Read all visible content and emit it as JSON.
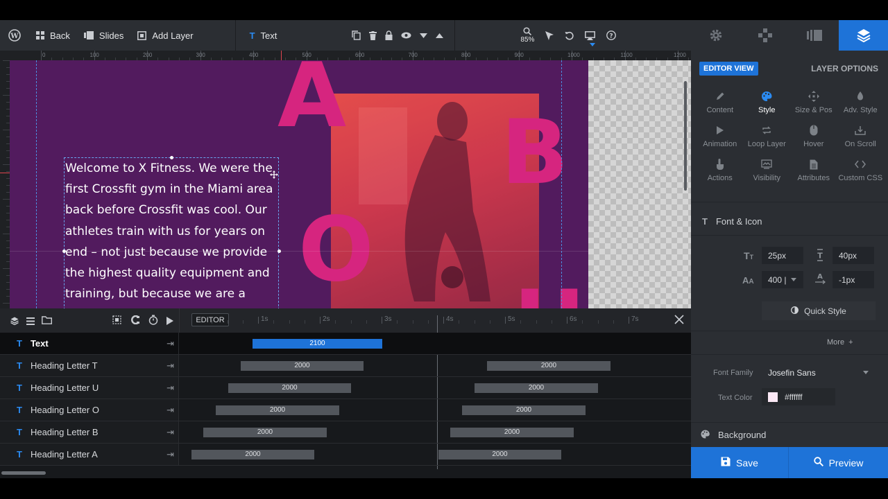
{
  "toolbar": {
    "back": "Back",
    "slides": "Slides",
    "add_layer": "Add Layer",
    "layer_type": "Text",
    "zoom": "85%"
  },
  "ruler_ticks": [
    "0",
    "100",
    "200",
    "300",
    "400",
    "500",
    "600",
    "700",
    "800",
    "900",
    "1000",
    "1100",
    "1200"
  ],
  "slide": {
    "letters": [
      "A",
      "B",
      "O",
      "U"
    ],
    "text": "Welcome to X Fitness. We were the first Crossfit gym in the Miami area back before Crossfit was cool. Our athletes train with us for years on end – not just because we provide the highest quality equipment and training, but because we are a family. If you're ready to join our family, stop by today!"
  },
  "timeline": {
    "editor_label": "EDITOR",
    "ticks": [
      "1s",
      "2s",
      "3s",
      "4s",
      "5s",
      "6s",
      "7s"
    ],
    "rows": [
      {
        "label": "Text",
        "bars": [
          {
            "value": "2100"
          }
        ]
      },
      {
        "label": "Heading Letter T",
        "bars": [
          {
            "value": "2000"
          },
          {
            "value": "2000"
          }
        ]
      },
      {
        "label": "Heading Letter U",
        "bars": [
          {
            "value": "2000"
          },
          {
            "value": "2000"
          }
        ]
      },
      {
        "label": "Heading Letter O",
        "bars": [
          {
            "value": "2000"
          },
          {
            "value": "2000"
          }
        ]
      },
      {
        "label": "Heading Letter B",
        "bars": [
          {
            "value": "2000"
          },
          {
            "value": "2000"
          }
        ]
      },
      {
        "label": "Heading Letter A",
        "bars": [
          {
            "value": "2000"
          },
          {
            "value": "2000"
          }
        ]
      }
    ]
  },
  "panel": {
    "editor_view": "EDITOR VIEW",
    "layer_options": "LAYER OPTIONS",
    "options": [
      {
        "label": "Content",
        "icon": "pencil-icon"
      },
      {
        "label": "Style",
        "icon": "palette-icon"
      },
      {
        "label": "Size & Pos",
        "icon": "move-icon"
      },
      {
        "label": "Adv. Style",
        "icon": "contrast-icon"
      },
      {
        "label": "Animation",
        "icon": "play-icon"
      },
      {
        "label": "Loop Layer",
        "icon": "loop-icon"
      },
      {
        "label": "Hover",
        "icon": "mouse-icon"
      },
      {
        "label": "On Scroll",
        "icon": "scroll-icon"
      },
      {
        "label": "Actions",
        "icon": "hand-icon"
      },
      {
        "label": "Visibility",
        "icon": "visibility-icon"
      },
      {
        "label": "Attributes",
        "icon": "document-icon"
      },
      {
        "label": "Custom CSS",
        "icon": "code-icon"
      }
    ],
    "font_icon": "Font & Icon",
    "font_size": "25px",
    "line_height": "40px",
    "font_weight": "400 |",
    "letter_spacing": "-1px",
    "quick_style": "Quick Style",
    "more": "More",
    "font_family_label": "Font Family",
    "font_family": "Josefin Sans",
    "text_color_label": "Text Color",
    "text_color": "#ffffff",
    "background": "Background"
  },
  "footer": {
    "save": "Save",
    "preview": "Preview"
  },
  "colors": {
    "accent": "#1e73d8",
    "letter": "#d6257f",
    "slide_bg": "#521b5e"
  }
}
